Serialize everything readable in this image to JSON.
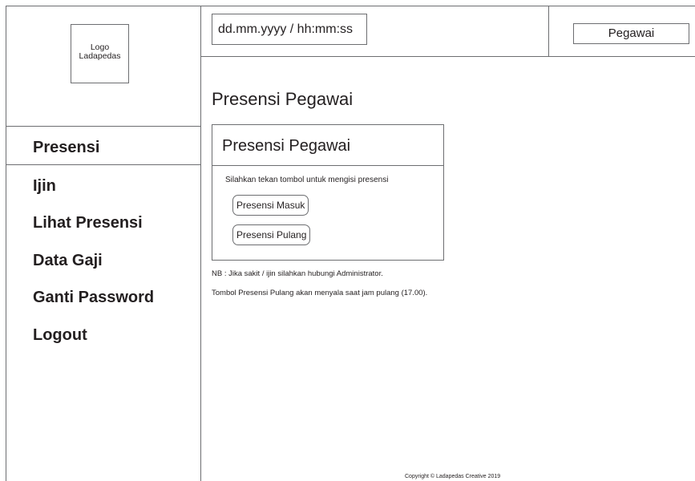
{
  "logo": {
    "line1": "Logo",
    "line2": "Ladapedas"
  },
  "sidebar": {
    "items": [
      {
        "label": "Presensi",
        "active": true
      },
      {
        "label": "Ijin"
      },
      {
        "label": "Lihat Presensi"
      },
      {
        "label": "Data Gaji"
      },
      {
        "label": "Ganti Password"
      },
      {
        "label": "Logout"
      }
    ]
  },
  "header": {
    "datetime": "dd.mm.yyyy / hh:mm:ss",
    "user_role": "Pegawai"
  },
  "main": {
    "page_title": "Presensi Pegawai",
    "card": {
      "title": "Presensi Pegawai",
      "instruction": "Silahkan tekan tombol untuk mengisi presensi",
      "btn_masuk": "Presensi Masuk",
      "btn_pulang": "Presensi Pulang"
    },
    "note1": "NB : Jika sakit / ijin silahkan hubungi Administrator.",
    "note2": "Tombol Presensi Pulang akan menyala saat jam pulang (17.00)."
  },
  "footer": {
    "copyright": "Copyright © Ladapedas Creative 2019"
  },
  "colors": {
    "border": "#6d6e71",
    "text": "#231f20",
    "background": "#ffffff"
  }
}
